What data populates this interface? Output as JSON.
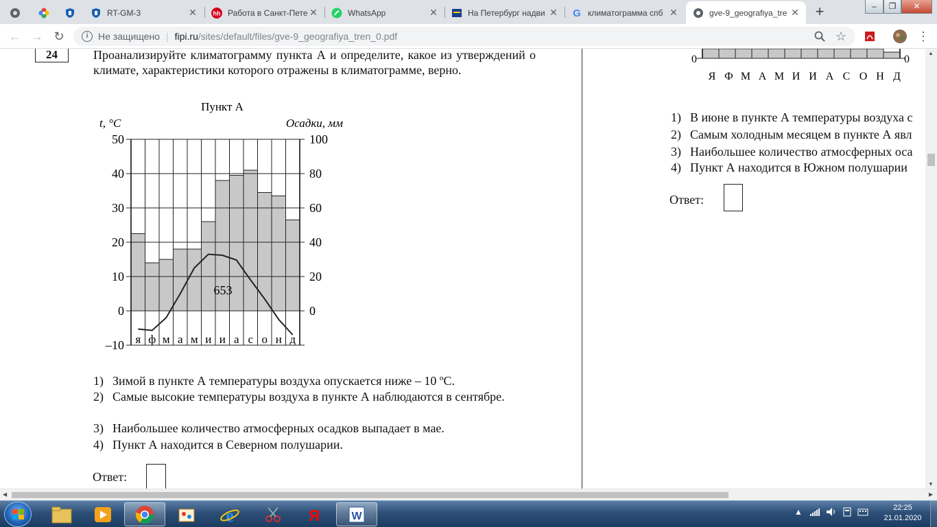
{
  "browser": {
    "tabs": [
      {
        "title": "",
        "icon": "chrome-apps-icon"
      },
      {
        "title": "",
        "icon": "flower-icon"
      },
      {
        "title": "",
        "icon": "shield-icon"
      },
      {
        "title": "RT-GM-3",
        "icon": "shield-icon"
      },
      {
        "title": "Работа в Санкт-Пете",
        "icon": "hh-icon"
      },
      {
        "title": "WhatsApp",
        "icon": "whatsapp-icon"
      },
      {
        "title": "На Петербург надви",
        "icon": "news-icon"
      },
      {
        "title": "климатограмма спб",
        "icon": "google-icon"
      },
      {
        "title": "gve-9_geografiya_tre",
        "icon": "globe-icon",
        "active": true
      }
    ],
    "newtab_label": "+",
    "url_security": "Не защищено",
    "url_host": "fipi.ru",
    "url_path": "/sites/default/files/gve-9_geografiya_tren_0.pdf"
  },
  "question": {
    "number": "24",
    "text": "Проанализируйте климатограмму пункта А и определите, какое из утверждений о климате, характеристики которого отражены в климатограмме, верно.",
    "options": [
      {
        "n": "1)",
        "text": "Зимой в пункте А температуры воздуха опускается ниже – 10 ºС."
      },
      {
        "n": "2)",
        "text": "Самые высокие температуры воздуха в пункте А наблюдаются в сентябре."
      },
      {
        "n": "3)",
        "text": "Наибольшее количество атмосферных осадков выпадает в мае."
      },
      {
        "n": "4)",
        "text": "Пункт А находится в Северном полушарии."
      }
    ],
    "answer_label": "Ответ:"
  },
  "right_panel": {
    "months": [
      "Я",
      "Ф",
      "М",
      "А",
      "М",
      "И",
      "И",
      "А",
      "С",
      "О",
      "Н",
      "Д"
    ],
    "zero_left": "0",
    "zero_right": "0",
    "options": [
      {
        "n": "1)",
        "text": "В июне в пункте А температуры воздуха с"
      },
      {
        "n": "2)",
        "text": "Самым холодным месяцем в пункте А явл"
      },
      {
        "n": "3)",
        "text": "Наибольшее количество атмосферных оса"
      },
      {
        "n": "4)",
        "text": "Пункт А находится в Южном полушарии"
      }
    ],
    "answer_label": "Ответ:"
  },
  "chart_data": {
    "type": "bar",
    "title": "Пункт А",
    "y_left_label": "t, °C",
    "y_right_label": "Осадки, мм",
    "y_left_ticks": [
      "50",
      "40",
      "30",
      "20",
      "10",
      "0",
      "–10"
    ],
    "y_right_ticks": [
      "100",
      "80",
      "60",
      "40",
      "20",
      "0"
    ],
    "y_left_lim": [
      -10,
      50
    ],
    "y_right_lim": [
      -20,
      100
    ],
    "categories": [
      "я",
      "ф",
      "м",
      "а",
      "м",
      "и",
      "и",
      "а",
      "с",
      "о",
      "н",
      "д"
    ],
    "series": [
      {
        "type": "bar",
        "axis": "right",
        "values": [
          45,
          28,
          30,
          36,
          36,
          52,
          76,
          79,
          82,
          69,
          67,
          53
        ]
      },
      {
        "type": "line",
        "axis": "left",
        "values": [
          -5.3,
          -5.7,
          -2,
          5,
          12.5,
          16.5,
          14.5,
          9,
          3.5,
          -2.5
        ]
      }
    ],
    "line_x_indices": [
      0,
      1,
      2,
      3,
      4,
      5,
      6,
      7,
      8,
      9,
      10,
      11
    ],
    "line_values_full": [
      -5.3,
      -5.7,
      -2,
      5,
      12.5,
      16.5,
      16.2,
      14.8,
      9,
      3.5,
      -2.5,
      -7
    ],
    "annotation": "653"
  },
  "taskbar": {
    "apps": [
      {
        "name": "explorer"
      },
      {
        "name": "media-player"
      },
      {
        "name": "chrome",
        "active": true
      },
      {
        "name": "paint"
      },
      {
        "name": "internet-explorer"
      },
      {
        "name": "snipping-tool"
      },
      {
        "name": "yandex"
      },
      {
        "name": "word"
      }
    ],
    "time": "22:25",
    "date": "21.01.2020"
  }
}
